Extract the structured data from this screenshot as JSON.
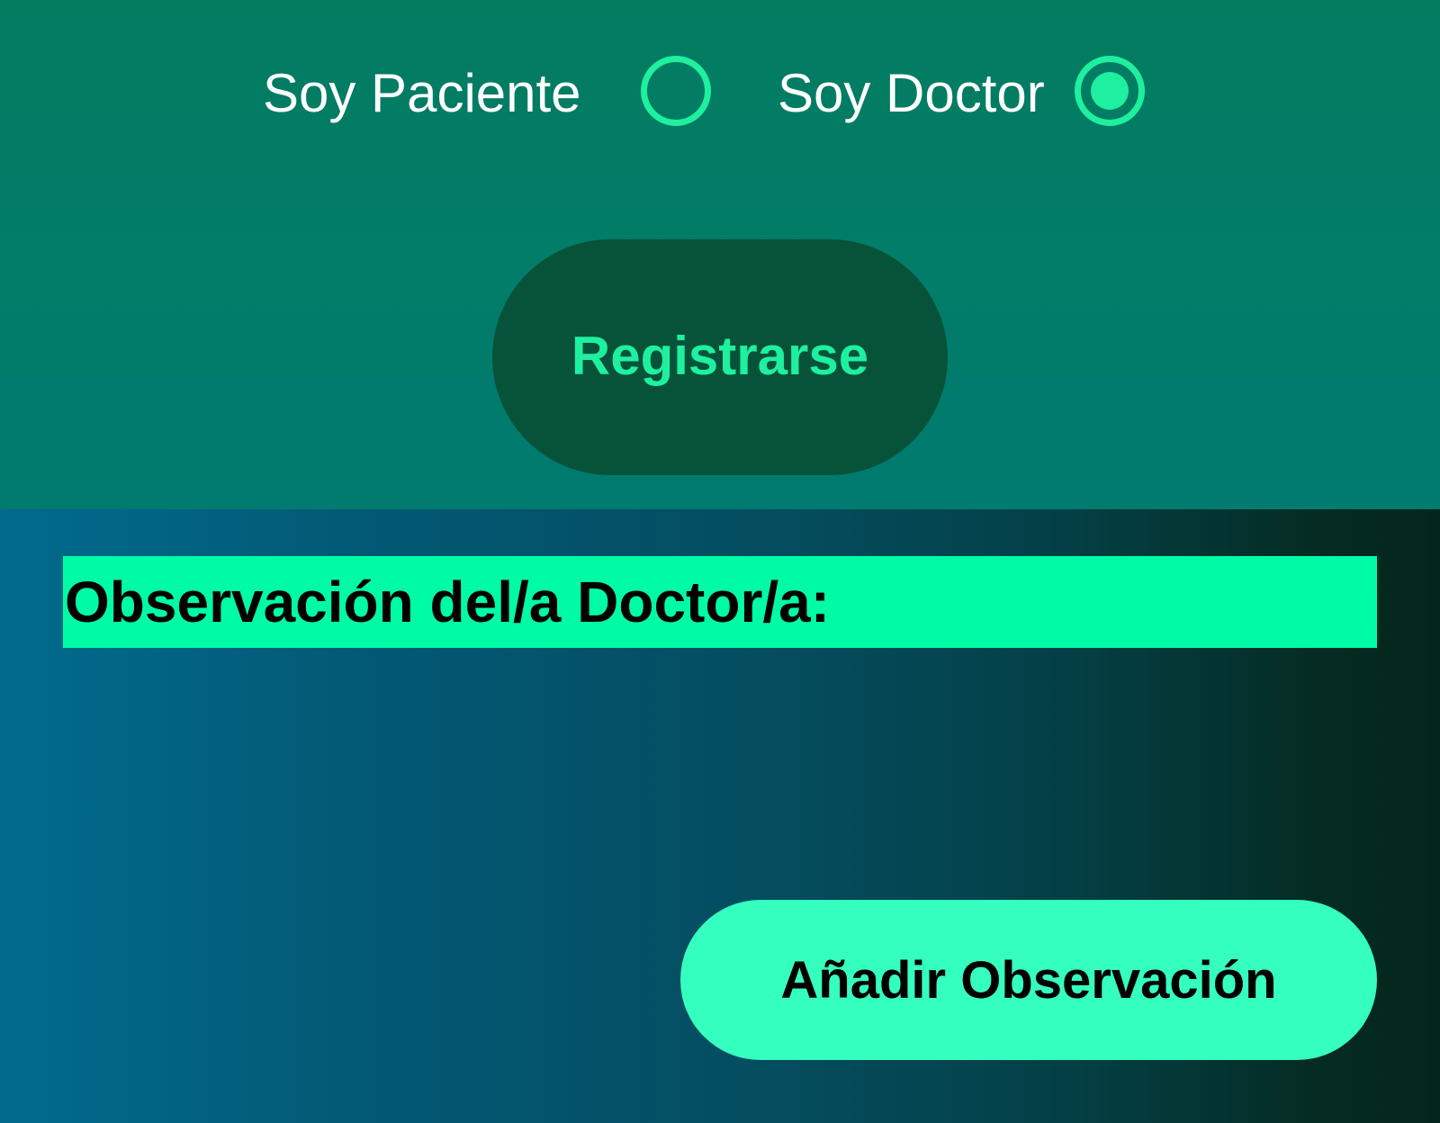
{
  "role_selector": {
    "patient_label": "Soy Paciente",
    "doctor_label": "Soy Doctor",
    "selected": "doctor"
  },
  "register_button": {
    "label": "Registrarse"
  },
  "observation": {
    "heading": "Observación del/a Doctor/a:",
    "content": "",
    "add_button_label": "Añadir Observación"
  },
  "colors": {
    "accent": "#1ef0a0",
    "register_button_bg": "#06533a",
    "heading_bg": "#00fba7",
    "add_button_bg": "#35ffbe"
  }
}
